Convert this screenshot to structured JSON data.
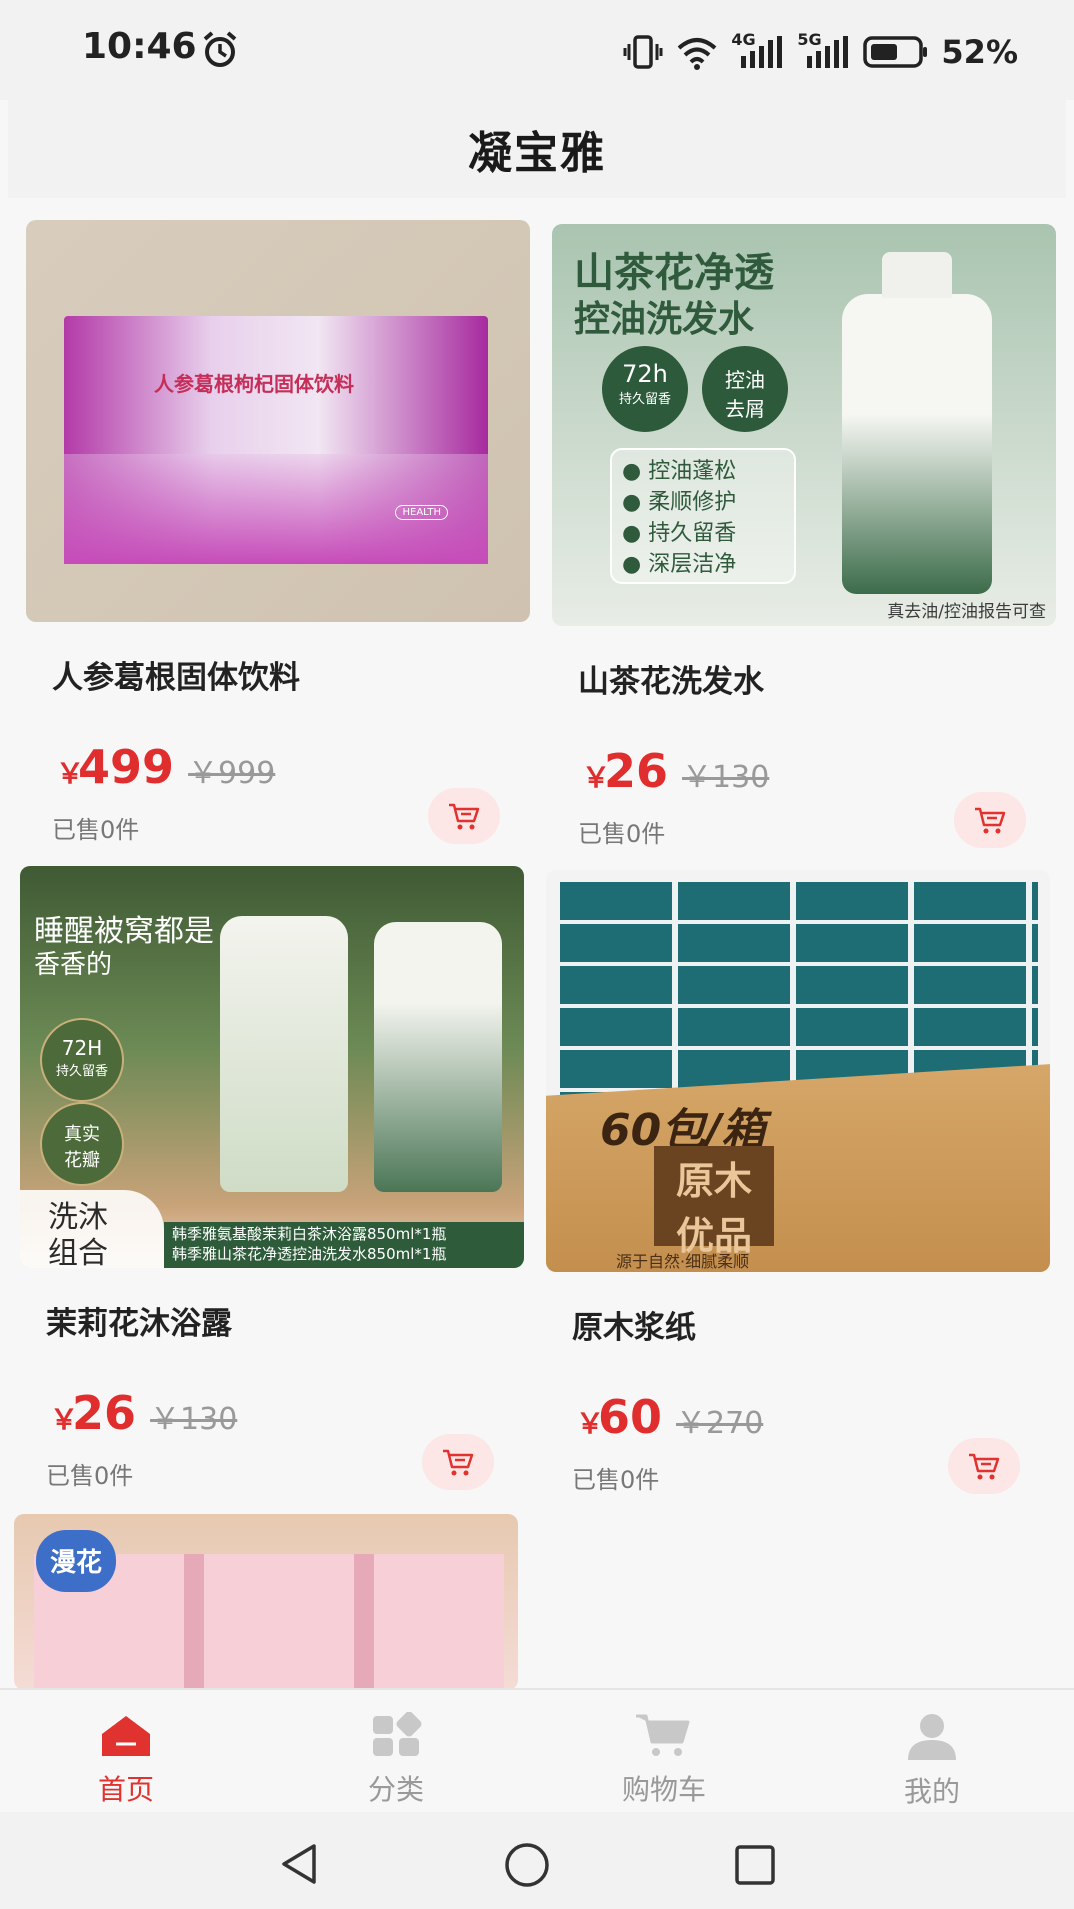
{
  "status": {
    "time": "10:46",
    "battery": "52%",
    "network1": "4G",
    "network2": "5G"
  },
  "header": {
    "title": "凝宝雅"
  },
  "products": [
    {
      "name": "人参葛根固体饮料",
      "price": "499",
      "original": "￥999",
      "sold": "已售0件",
      "currency": "￥",
      "image_text": {
        "title": "人参葛根枸杞固体饮料",
        "brand": "HEALTH"
      }
    },
    {
      "name": "山茶花洗发水",
      "price": "26",
      "original": "￥130",
      "sold": "已售0件",
      "currency": "￥",
      "image_text": {
        "title1": "山茶花净透",
        "title2": "控油洗发水",
        "badge1a": "72h",
        "badge1b": "持久留香",
        "badge2a": "控油",
        "badge2b": "去屑",
        "features": [
          "控油蓬松",
          "柔顺修护",
          "持久留香",
          "深层洁净"
        ],
        "footer": "真去油/控油报告可查"
      }
    },
    {
      "name": "茉莉花沐浴露",
      "price": "26",
      "original": "￥130",
      "sold": "已售0件",
      "currency": "￥",
      "image_text": {
        "title1": "睡醒被窝都是",
        "title2": "香香的",
        "badge1a": "72H",
        "badge1b": "持久留香",
        "badge2a": "真实",
        "badge2b": "花瓣",
        "combo1": "洗沐",
        "combo2": "组合",
        "line1": "韩季雅氨基酸茉莉白茶沐浴露850ml*1瓶",
        "line2": "韩季雅山茶花净透控油洗发水850ml*1瓶"
      }
    },
    {
      "name": "原木浆纸",
      "price": "60",
      "original": "￥270",
      "sold": "已售0件",
      "currency": "￥",
      "image_text": {
        "pack": "60包/箱",
        "box1": "原木",
        "box2": "优品",
        "slogan": "源于自然·细腻柔顺"
      }
    },
    {
      "image_text": {
        "brand": "漫花"
      }
    }
  ],
  "tabs": [
    {
      "label": "首页",
      "active": true
    },
    {
      "label": "分类",
      "active": false
    },
    {
      "label": "购物车",
      "active": false
    },
    {
      "label": "我的",
      "active": false
    }
  ],
  "colors": {
    "accent": "#e0322e",
    "cart_bg": "#fde6e6"
  }
}
